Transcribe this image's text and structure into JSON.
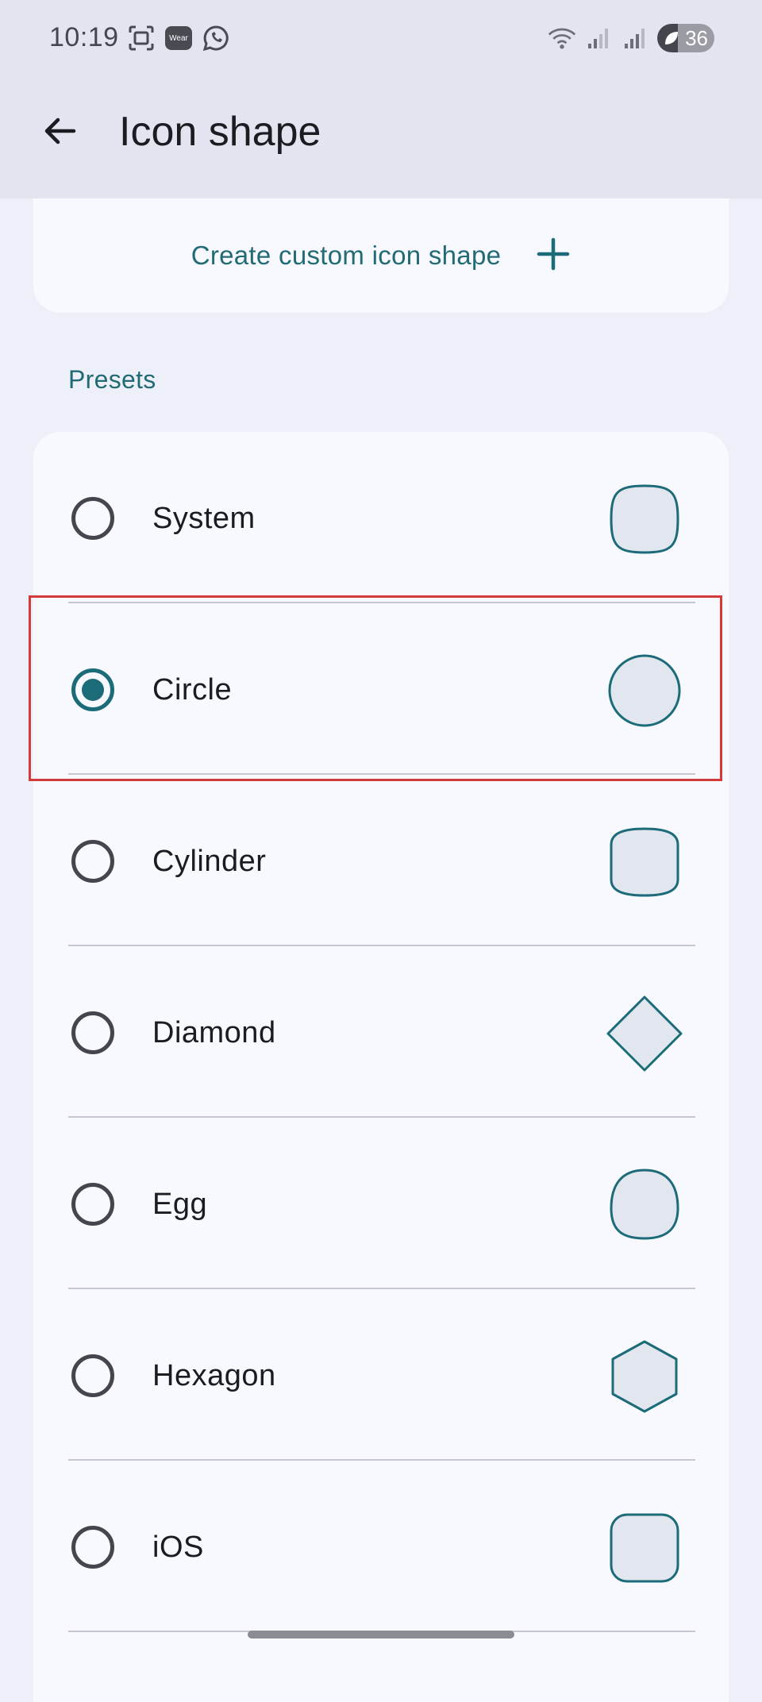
{
  "status_bar": {
    "time": "10:19",
    "wear_badge": "Wear",
    "battery_level": "36",
    "icons_left": [
      "screenshot-icon",
      "wear-icon",
      "whatsapp-icon"
    ],
    "icons_right": [
      "wifi-icon",
      "signal-icon",
      "signal-icon",
      "battery-icon"
    ]
  },
  "top_bar": {
    "title": "Icon shape",
    "back_icon": "arrow-left-icon"
  },
  "custom_shape": {
    "label": "Create custom icon shape",
    "icon": "plus-icon"
  },
  "presets": {
    "header": "Presets",
    "items": [
      {
        "label": "System",
        "selected": false,
        "shape": "squircle"
      },
      {
        "label": "Circle",
        "selected": true,
        "shape": "circle"
      },
      {
        "label": "Cylinder",
        "selected": false,
        "shape": "cylinder"
      },
      {
        "label": "Diamond",
        "selected": false,
        "shape": "diamond"
      },
      {
        "label": "Egg",
        "selected": false,
        "shape": "egg"
      },
      {
        "label": "Hexagon",
        "selected": false,
        "shape": "hexagon"
      },
      {
        "label": "iOS",
        "selected": false,
        "shape": "rounded-square"
      }
    ]
  },
  "colors": {
    "accent": "#1c6b78",
    "shape_fill": "#e2e6ee",
    "highlight": "#d33a3a"
  }
}
